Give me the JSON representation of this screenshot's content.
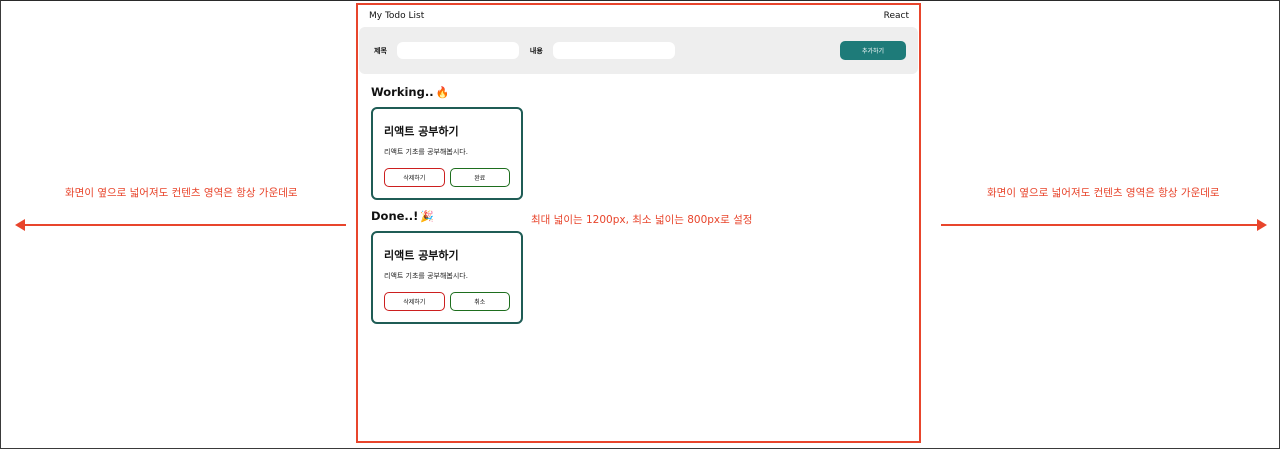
{
  "annotations": {
    "left": "화면이 옆으로 넓어져도 컨텐츠 영역은 항상 가운데로",
    "right": "화면이 옆으로 넓어져도 컨텐츠 영역은 항상 가운데로",
    "middle": "최대 넓이는 1200px, 최소 넓이는 800px로 설정"
  },
  "header": {
    "title": "My Todo List",
    "right_label": "React"
  },
  "form": {
    "title_label": "제목",
    "title_value": "",
    "content_label": "내용",
    "content_value": "",
    "add_label": "추가하기"
  },
  "working": {
    "heading": "Working..",
    "emoji": "🔥",
    "todos": [
      {
        "title": "리액트 공부하기",
        "body": "리액트 기초를 공부해봅시다.",
        "delete_label": "삭제하기",
        "toggle_label": "완료"
      }
    ]
  },
  "done": {
    "heading": "Done..!",
    "emoji": "🎉",
    "todos": [
      {
        "title": "리액트 공부하기",
        "body": "리액트 기초를 공부해봅시다.",
        "delete_label": "삭제하기",
        "toggle_label": "취소"
      }
    ]
  },
  "colors": {
    "annotation": "#e8452c",
    "accent": "#1e7b79",
    "card_border": "#1f5c55",
    "delete_border": "#cc1f1f",
    "toggle_border": "#1e6e1e"
  }
}
